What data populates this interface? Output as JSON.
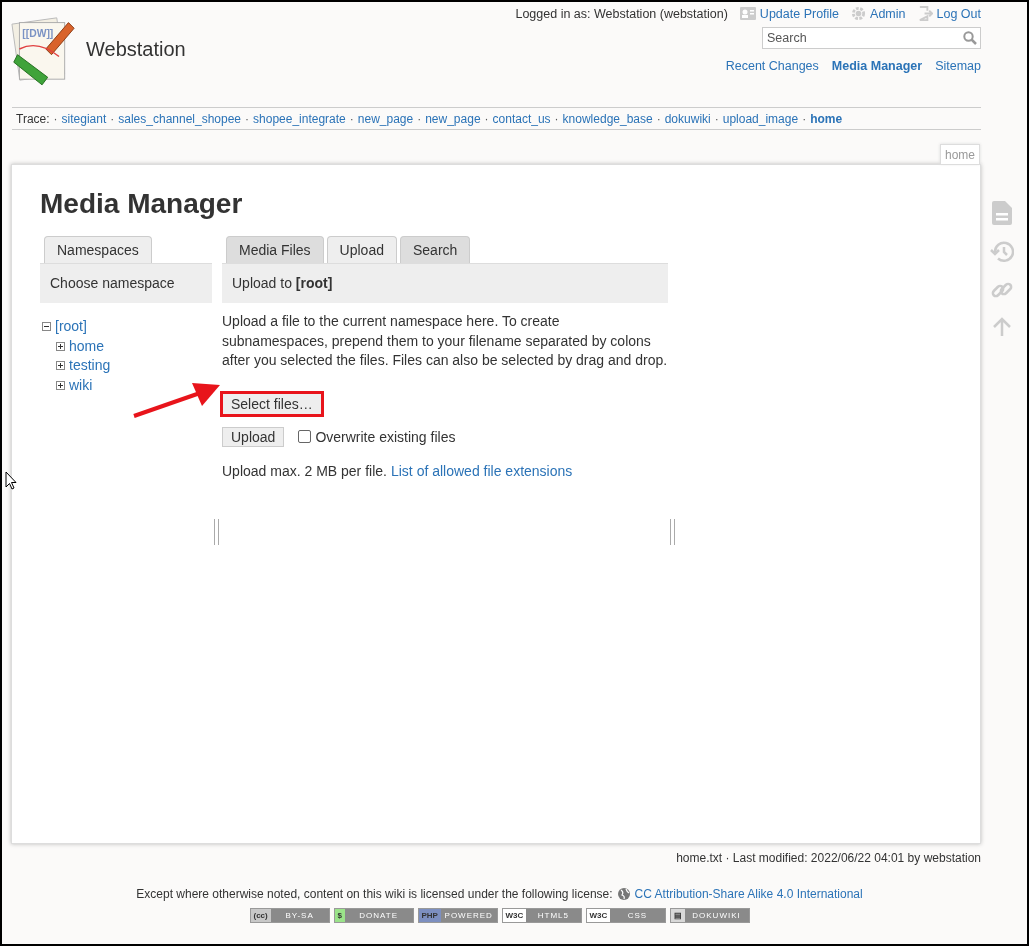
{
  "header": {
    "logo_text": "[[DW]]",
    "site_title": "Webstation",
    "user": "Logged in as: Webstation (webstation)",
    "user_tools": [
      {
        "label": "Update Profile"
      },
      {
        "label": "Admin"
      },
      {
        "label": "Log Out"
      }
    ],
    "search": {
      "placeholder": "Search"
    },
    "site_tools": [
      {
        "label": "Recent Changes",
        "selected": false
      },
      {
        "label": "Media Manager",
        "selected": true
      },
      {
        "label": "Sitemap",
        "selected": false
      }
    ]
  },
  "trace": {
    "label": "Trace:",
    "separator": "·",
    "items": [
      {
        "label": "sitegiant",
        "current": false
      },
      {
        "label": "sales_channel_shopee",
        "current": false
      },
      {
        "label": "shopee_integrate",
        "current": false
      },
      {
        "label": "new_page",
        "current": false
      },
      {
        "label": "new_page",
        "current": false
      },
      {
        "label": "contact_us",
        "current": false
      },
      {
        "label": "knowledge_base",
        "current": false
      },
      {
        "label": "dokuwiki",
        "current": false
      },
      {
        "label": "upload_image",
        "current": false
      },
      {
        "label": "home",
        "current": true
      }
    ]
  },
  "page_tab": "home",
  "media_manager": {
    "title": "Media Manager",
    "namespaces": {
      "tab": "Namespaces",
      "header": "Choose namespace",
      "tree": [
        {
          "label": "[root]",
          "expanded": true,
          "children": [
            {
              "label": "home",
              "expanded": false
            },
            {
              "label": "testing",
              "expanded": false
            },
            {
              "label": "wiki",
              "expanded": false
            }
          ]
        }
      ]
    },
    "tabs": [
      {
        "label": "Media Files",
        "selected": false
      },
      {
        "label": "Upload",
        "selected": true
      },
      {
        "label": "Search",
        "selected": false
      }
    ],
    "upload": {
      "header": "Upload to **[root]**",
      "intro": "Upload a file to the current namespace here. To create subnamespaces, prepend them to your filename separated by colons after you selected the files. Files can also be selected by drag and drop.",
      "select_button": "Select files…",
      "highlighted": true,
      "upload_button": "Upload",
      "overwrite": {
        "label": "Overwrite existing files",
        "checked": false
      },
      "max_text": "Upload max. 2 MB per file.",
      "extensions_link": "List of allowed file extensions"
    }
  },
  "annotation_arrow": true,
  "footer": {
    "doc_info": "home.txt · Last modified: 2022/06/22 04:01 by webstation",
    "license_text": "Except where otherwise noted, content on this wiki is licensed under the following license:",
    "license_link": "CC Attribution-Share Alike 4.0 International",
    "badges": [
      {
        "mark": "(cc)",
        "label": "BY-SA",
        "color": "#c8c8c8"
      },
      {
        "mark": "$",
        "label": "DONATE",
        "color": "#9be38a"
      },
      {
        "mark": "PHP",
        "label": "POWERED",
        "color": "#7d8fc0"
      },
      {
        "mark": "W3C",
        "label": "HTML5",
        "color": "#ffffff"
      },
      {
        "mark": "W3C",
        "label": "CSS",
        "color": "#ffffff"
      },
      {
        "mark": "▤",
        "label": "DOKUWIKI",
        "color": "#d8d8d8"
      }
    ]
  }
}
